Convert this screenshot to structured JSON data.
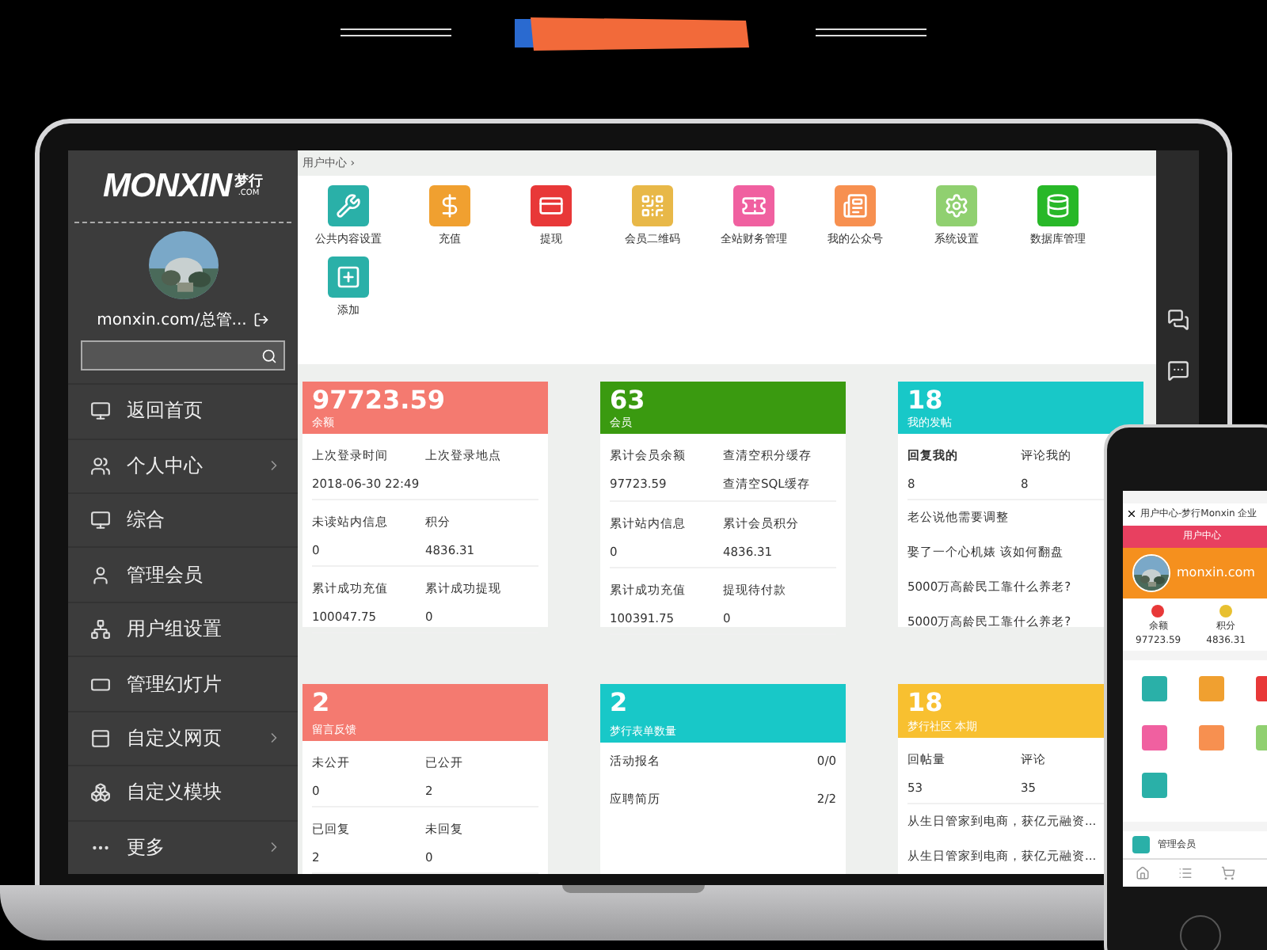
{
  "sidebar": {
    "logo": "MONXIN",
    "logo_badge": "梦行",
    "logo_domain": ".COM",
    "user": "monxin.com/总管...",
    "items": [
      {
        "label": "返回首页",
        "expandable": false
      },
      {
        "label": "个人中心",
        "expandable": true
      },
      {
        "label": "综合",
        "expandable": false
      },
      {
        "label": "管理会员",
        "expandable": false
      },
      {
        "label": "用户组设置",
        "expandable": false
      },
      {
        "label": "管理幻灯片",
        "expandable": false
      },
      {
        "label": "自定义网页",
        "expandable": true
      },
      {
        "label": "自定义模块",
        "expandable": false
      },
      {
        "label": "更多",
        "expandable": true
      }
    ]
  },
  "breadcrumb": "用户中心 ›",
  "shortcuts": [
    {
      "label": "公共内容设置",
      "color": "#2ab0a8"
    },
    {
      "label": "充值",
      "color": "#f0a030"
    },
    {
      "label": "提现",
      "color": "#e83838"
    },
    {
      "label": "会员二维码",
      "color": "#e8b848"
    },
    {
      "label": "全站财务管理",
      "color": "#f060a0"
    },
    {
      "label": "我的公众号",
      "color": "#f79050"
    },
    {
      "label": "系统设置",
      "color": "#90d070"
    },
    {
      "label": "数据库管理",
      "color": "#28b828"
    },
    {
      "label": "添加",
      "color": "#2ab0a8"
    }
  ],
  "cards": [
    {
      "value": "97723.59",
      "title": "余额",
      "color": "#f47a70",
      "cells": [
        {
          "label": "上次登录时间",
          "value": "2018-06-30 22:49"
        },
        {
          "label": "上次登录地点"
        },
        {
          "label": "未读站内信息",
          "value": "0"
        },
        {
          "label": "积分",
          "value": "4836.31"
        },
        {
          "label": "累计成功充值",
          "value": "100047.75"
        },
        {
          "label": "累计成功提现",
          "value": "0"
        }
      ]
    },
    {
      "value": "63",
      "title": "会员",
      "color": "#3a9a10",
      "cells": [
        {
          "label": "累计会员余额",
          "value": "97723.59"
        },
        {
          "label": "查清空积分缓存",
          "value": "查清空SQL缓存"
        },
        {
          "label": "累计站内信息",
          "value": "0"
        },
        {
          "label": "累计会员积分",
          "value": "4836.31"
        },
        {
          "label": "累计成功充值",
          "value": "100391.75"
        },
        {
          "label": "提现待付款",
          "value": "0"
        }
      ]
    },
    {
      "value": "18",
      "title": "我的发帖",
      "color": "#18c8c8",
      "cells": [
        {
          "label": "**回复我的**",
          "value": "8"
        },
        {
          "label": "评论我的",
          "value": "8"
        }
      ],
      "lines": [
        "老公说他需要调整",
        "娶了一个心机婊 该如何翻盘",
        "5000万高龄民工靠什么养老?",
        "5000万高龄民工靠什么养老?"
      ]
    },
    {
      "value": "2",
      "title": "留言反馈",
      "color": "#f47a70",
      "cells": [
        {
          "label": "未公开",
          "value": "0"
        },
        {
          "label": "已公开",
          "value": "2"
        },
        {
          "label": "已回复",
          "value": "2"
        },
        {
          "label": "未回复",
          "value": "0"
        }
      ]
    },
    {
      "value": "2",
      "title": "梦行表单数量",
      "color": "#18c8c8",
      "rows": [
        {
          "label": "活动报名",
          "value": "0/0"
        },
        {
          "label": "应聘简历",
          "value": "2/2"
        }
      ]
    },
    {
      "value": "18",
      "title": "梦行社区 本期",
      "color": "#f8c030",
      "cells": [
        {
          "label": "回帖量",
          "value": "53"
        },
        {
          "label": "评论",
          "value": "35"
        }
      ],
      "lines": [
        "从生日管家到电商，获亿元融资...",
        "从生日管家到电商，获亿元融资..."
      ]
    }
  ],
  "phone": {
    "title": "用户中心-梦行Monxin 企业",
    "header": "用户中心",
    "user": "monxin.com",
    "stats": [
      {
        "label": "余额",
        "value": "97723.59",
        "color": "#e83838"
      },
      {
        "label": "积分",
        "value": "4836.31",
        "color": "#e8c030"
      }
    ],
    "shortcuts": [
      {
        "color": "#2ab0a8"
      },
      {
        "color": "#f0a030"
      },
      {
        "color": "#e83838"
      },
      {
        "color": "#f060a0"
      },
      {
        "color": "#f79050"
      },
      {
        "color": "#90d070"
      },
      {
        "color": "#2ab0a8"
      }
    ],
    "menu_item": "管理会员"
  }
}
